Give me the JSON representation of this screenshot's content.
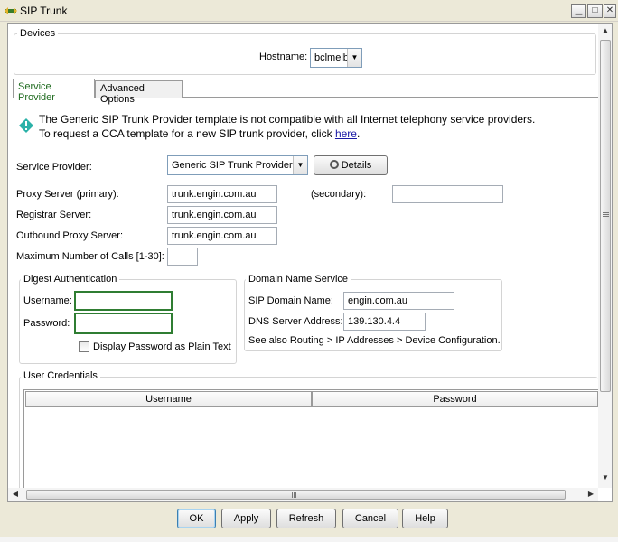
{
  "window": {
    "title": "SIP Trunk",
    "controls": [
      "minimize",
      "maximize",
      "close"
    ]
  },
  "devices": {
    "group_label": "Devices",
    "hostname_label": "Hostname:",
    "hostname_value": "bclmelb"
  },
  "tabs": [
    {
      "label": "Service Provider",
      "active": true
    },
    {
      "label": "Advanced Options",
      "active": false
    }
  ],
  "notice": {
    "line1": "The Generic SIP Trunk Provider template is not compatible with all Internet telephony service providers.",
    "line2_prefix": "To request a CCA template for a new SIP trunk provider, click ",
    "link": "here",
    "line2_suffix": "."
  },
  "form": {
    "service_provider_label": "Service Provider:",
    "service_provider_value": "Generic SIP Trunk Provider",
    "details_button": "Details",
    "proxy_primary_label": "Proxy Server (primary):",
    "proxy_primary_value": "trunk.engin.com.au",
    "proxy_secondary_label": "(secondary):",
    "proxy_secondary_value": "",
    "registrar_label": "Registrar Server:",
    "registrar_value": "trunk.engin.com.au",
    "outbound_proxy_label": "Outbound Proxy Server:",
    "outbound_proxy_value": "trunk.engin.com.au",
    "max_calls_label": "Maximum Number of Calls [1-30]:",
    "max_calls_value": ""
  },
  "digest": {
    "group_label": "Digest Authentication",
    "username_label": "Username:",
    "username_value": "",
    "password_label": "Password:",
    "password_value": "",
    "show_plain_label": "Display Password as Plain Text",
    "show_plain_checked": false
  },
  "dns": {
    "group_label": "Domain Name Service",
    "sip_domain_label": "SIP Domain Name:",
    "sip_domain_value": "engin.com.au",
    "dns_server_label": "DNS Server Address:",
    "dns_server_value": "139.130.4.4",
    "see_also": "See also Routing > IP Addresses > Device Configuration."
  },
  "credentials": {
    "group_label": "User Credentials",
    "columns": [
      "Username",
      "Password"
    ],
    "rows": []
  },
  "footer": {
    "buttons": [
      "OK",
      "Apply",
      "Refresh",
      "Cancel",
      "Help"
    ]
  },
  "colors": {
    "accent_green": "#2f7d32",
    "tab_active_text": "#1f6b1f",
    "link_blue": "#1a1aa6",
    "info_icon": "#2bb1a8"
  }
}
